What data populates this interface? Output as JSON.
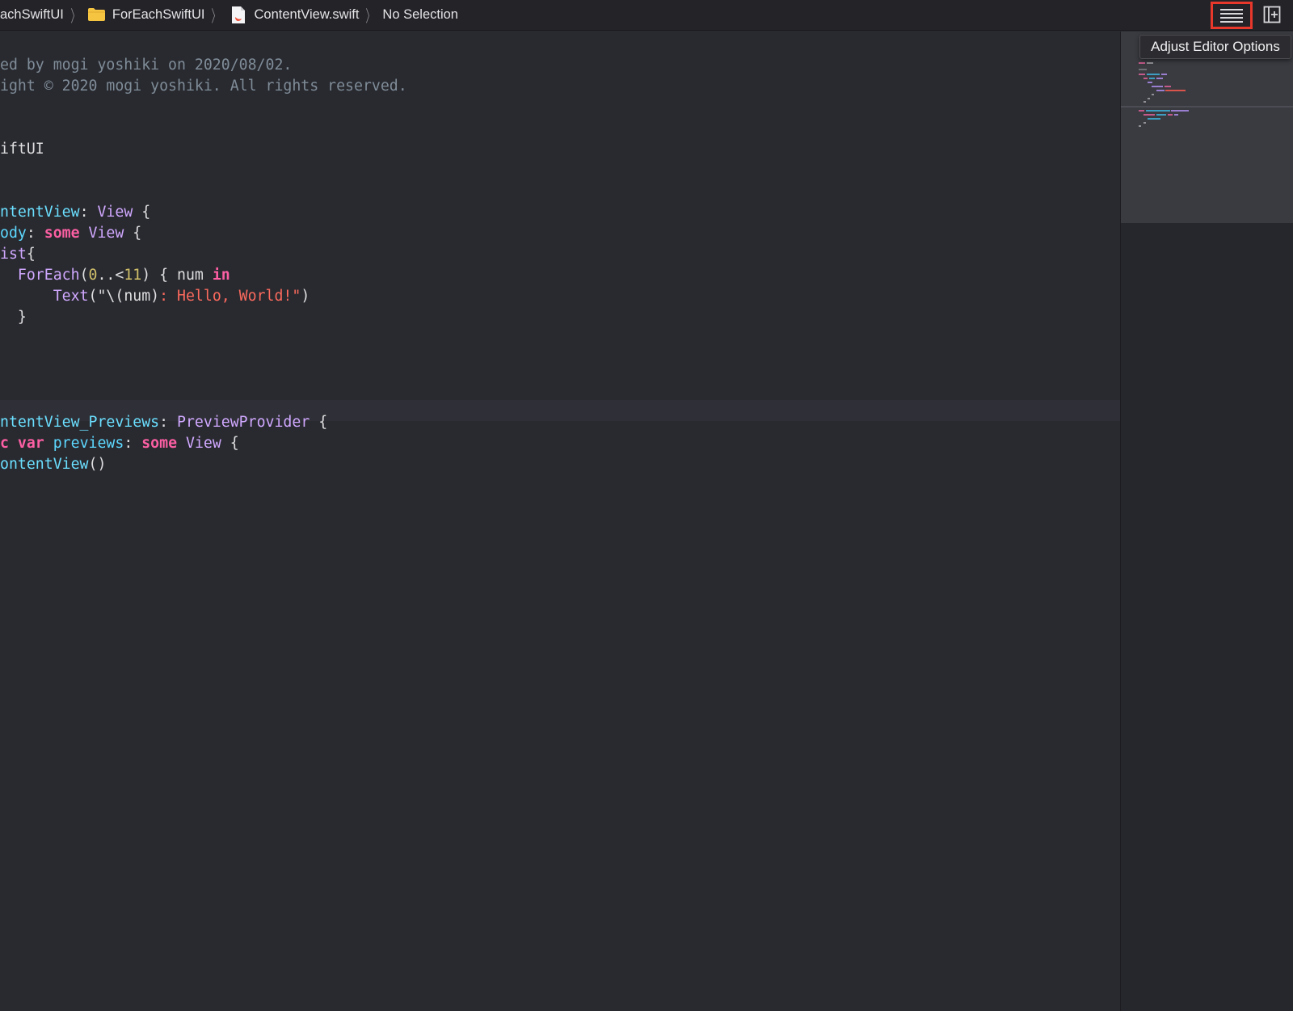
{
  "jumpbar": {
    "crumbs": [
      {
        "label": "achSwiftUI",
        "icon": ""
      },
      {
        "label": "ForEachSwiftUI",
        "icon": "folder-icon"
      },
      {
        "label": "ContentView.swift",
        "icon": "swift-file-icon"
      },
      {
        "label": "No Selection",
        "icon": ""
      }
    ],
    "separator": "〉",
    "editor_options_icon": "lines-icon",
    "split_icon": "add-editor-icon"
  },
  "tooltip": {
    "label": "Adjust Editor Options"
  },
  "editor": {
    "lines": [
      [
        {
          "t": "ed by mogi yoshiki on 2020/08/02.",
          "c": "c-comment"
        }
      ],
      [
        {
          "t": "ight © 2020 mogi yoshiki. All rights reserved.",
          "c": "c-comment"
        }
      ],
      [],
      [],
      [
        {
          "t": "iftUI",
          "c": "c-plain"
        }
      ],
      [],
      [],
      [
        {
          "t": "ntentView",
          "c": "c-type"
        },
        {
          "t": ": ",
          "c": "c-plain"
        },
        {
          "t": "View",
          "c": "c-proj"
        },
        {
          "t": " {",
          "c": "c-plain"
        }
      ],
      [
        {
          "t": "ody",
          "c": "c-prop"
        },
        {
          "t": ": ",
          "c": "c-plain"
        },
        {
          "t": "some",
          "c": "c-kw"
        },
        {
          "t": " ",
          "c": "c-plain"
        },
        {
          "t": "View",
          "c": "c-proj"
        },
        {
          "t": " {",
          "c": "c-plain"
        }
      ],
      [
        {
          "t": "ist",
          "c": "c-proj"
        },
        {
          "t": "{",
          "c": "c-plain"
        }
      ],
      [
        {
          "t": "  ",
          "c": "c-plain"
        },
        {
          "t": "ForEach",
          "c": "c-proj"
        },
        {
          "t": "(",
          "c": "c-plain"
        },
        {
          "t": "0",
          "c": "c-num"
        },
        {
          "t": "..<",
          "c": "c-plain"
        },
        {
          "t": "11",
          "c": "c-num"
        },
        {
          "t": ") { num ",
          "c": "c-plain"
        },
        {
          "t": "in",
          "c": "c-kw"
        }
      ],
      [
        {
          "t": "      ",
          "c": "c-plain"
        },
        {
          "t": "Text",
          "c": "c-proj"
        },
        {
          "t": "(\"\\(num)",
          "c": "c-plain"
        },
        {
          "t": ": Hello, World!\"",
          "c": "c-str"
        },
        {
          "t": ")",
          "c": "c-plain"
        }
      ],
      [
        {
          "t": "  }",
          "c": "c-plain"
        }
      ],
      [],
      [],
      [],
      [],
      [
        {
          "t": "ntentView_Previews",
          "c": "c-type"
        },
        {
          "t": ": ",
          "c": "c-plain"
        },
        {
          "t": "PreviewProvider",
          "c": "c-proj"
        },
        {
          "t": " {",
          "c": "c-plain"
        }
      ],
      [
        {
          "t": "c",
          "c": "c-kw"
        },
        {
          "t": " ",
          "c": "c-plain"
        },
        {
          "t": "var",
          "c": "c-kw"
        },
        {
          "t": " ",
          "c": "c-plain"
        },
        {
          "t": "previews",
          "c": "c-prop"
        },
        {
          "t": ": ",
          "c": "c-plain"
        },
        {
          "t": "some",
          "c": "c-kw"
        },
        {
          "t": " ",
          "c": "c-plain"
        },
        {
          "t": "View",
          "c": "c-proj"
        },
        {
          "t": " {",
          "c": "c-plain"
        }
      ],
      [
        {
          "t": "ontentView",
          "c": "c-type"
        },
        {
          "t": "()",
          "c": "c-plain"
        }
      ]
    ]
  }
}
